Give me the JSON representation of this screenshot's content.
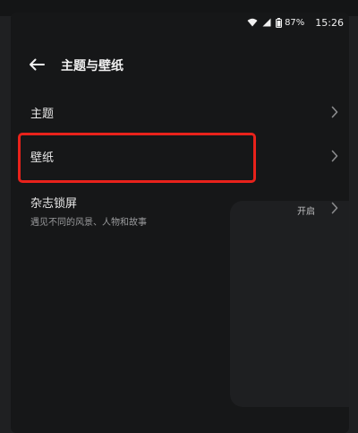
{
  "status_bar": {
    "battery": "87%",
    "time": "15:26"
  },
  "header": {
    "title": "主题与壁纸"
  },
  "settings": {
    "theme": {
      "label": "主题"
    },
    "wallpaper": {
      "label": "壁纸"
    },
    "magazine_lockscreen": {
      "label": "杂志锁屏",
      "description": "遇见不同的风景、人物和故事",
      "state": "开启"
    }
  },
  "colors": {
    "annotation_box": "#e8221b",
    "background": "#161718"
  }
}
